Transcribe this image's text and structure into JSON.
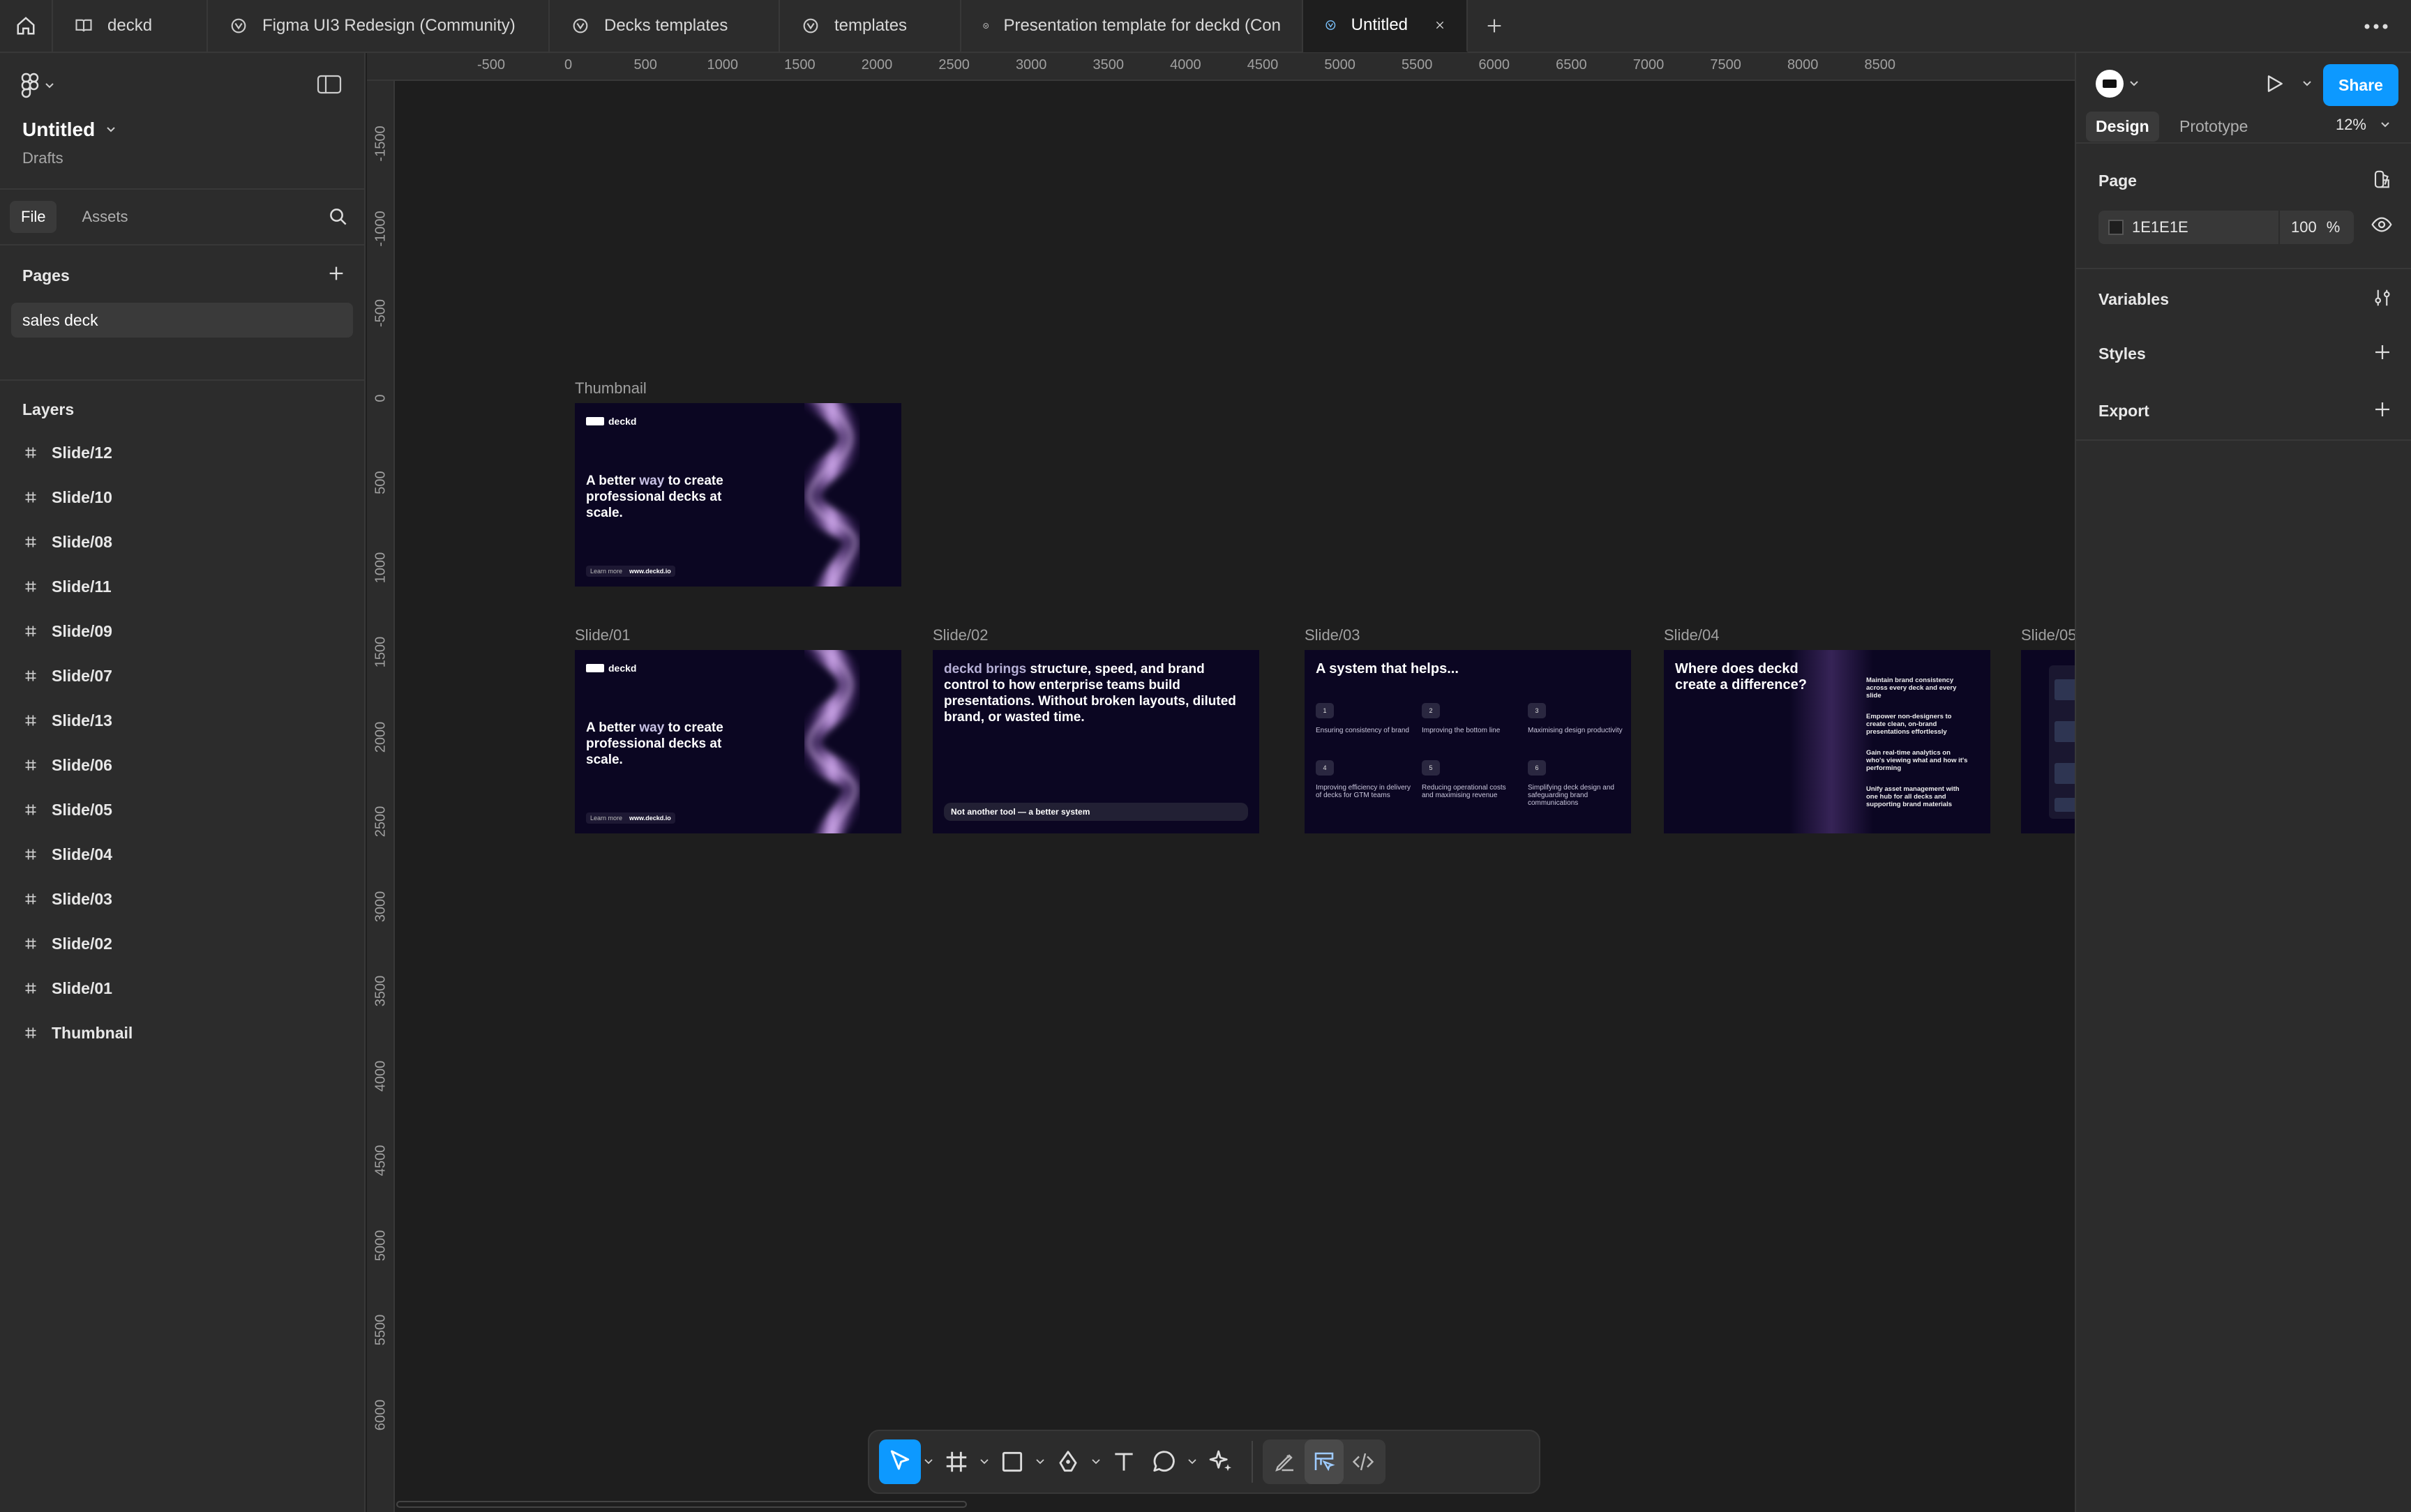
{
  "tabs": [
    {
      "label": "deckd",
      "icon": "book-icon"
    },
    {
      "label": "Figma UI3 Redesign (Community)",
      "icon": "community-file-icon"
    },
    {
      "label": "Decks templates",
      "icon": "community-file-icon"
    },
    {
      "label": "templates",
      "icon": "community-file-icon"
    },
    {
      "label": "Presentation template for deckd (Con",
      "icon": "community-file-icon"
    },
    {
      "label": "Untitled",
      "icon": "community-file-icon",
      "active": true
    }
  ],
  "file": {
    "name": "Untitled",
    "location": "Drafts"
  },
  "left_tabs": {
    "file": "File",
    "assets": "Assets"
  },
  "pages": {
    "title": "Pages",
    "items": [
      "sales deck"
    ]
  },
  "layers": {
    "title": "Layers",
    "items": [
      "Slide/12",
      "Slide/10",
      "Slide/08",
      "Slide/11",
      "Slide/09",
      "Slide/07",
      "Slide/13",
      "Slide/06",
      "Slide/05",
      "Slide/04",
      "Slide/03",
      "Slide/02",
      "Slide/01",
      "Thumbnail"
    ]
  },
  "ruler_top": [
    "-500",
    "0",
    "500",
    "1000",
    "1500",
    "2000",
    "2500",
    "3000",
    "3500",
    "4000",
    "4500",
    "5000",
    "5500",
    "6000",
    "6500",
    "7000",
    "7500",
    "8000",
    "8500"
  ],
  "ruler_left": [
    "-1500",
    "-1000",
    "-500",
    "0",
    "500",
    "1000",
    "1500",
    "2000",
    "2500",
    "3000",
    "3500",
    "4000",
    "4500",
    "5000",
    "5500",
    "6000"
  ],
  "canvas": {
    "thumbnail_label": "Thumbnail",
    "slide_labels": [
      "Slide/01",
      "Slide/02",
      "Slide/03",
      "Slide/04",
      "Slide/05"
    ],
    "brand": "deckd",
    "hero_a": "A better ",
    "hero_b": "way",
    "hero_c": " to create professional decks at scale.",
    "pill_left": "Learn more",
    "pill_url": "www.deckd.io",
    "s2_lead": "deckd brings ",
    "s2_body": "structure, speed, and brand control to how enterprise teams build presentations. Without broken layouts, diluted brand, or wasted time.",
    "s2_bar": "Not another tool — a better system",
    "s3_title": "A system that helps...",
    "s3_items": [
      {
        "n": "1",
        "t": "Ensuring consistency of brand"
      },
      {
        "n": "2",
        "t": "Improving the bottom line"
      },
      {
        "n": "3",
        "t": "Maximising design productivity"
      },
      {
        "n": "4",
        "t": "Improving efficiency in delivery of decks for GTM teams"
      },
      {
        "n": "5",
        "t": "Reducing operational costs and maximising revenue"
      },
      {
        "n": "6",
        "t": "Simplifying deck design and safeguarding brand communications"
      }
    ],
    "s4_title": "Where does deckd create a difference?",
    "s4_items": [
      "Maintain brand consistency across every deck and every slide",
      "Empower non-designers to create clean, on-brand presentations effortlessly",
      "Gain real-time analytics on who's viewing what and how it's performing",
      "Unify asset management with one hub for all decks and supporting brand materials"
    ]
  },
  "right": {
    "share": "Share",
    "tabs": {
      "design": "Design",
      "prototype": "Prototype"
    },
    "zoom": "12%",
    "page_title": "Page",
    "page_color": "1E1E1E",
    "page_opacity": "100",
    "percent": "%",
    "sections": [
      "Variables",
      "Styles",
      "Export"
    ]
  },
  "help": "?",
  "colors": {
    "accent": "#0d99ff",
    "canvas_bg": "#1e1e1e",
    "panel_bg": "#2c2c2c",
    "slide_bg": "#0b0622"
  }
}
